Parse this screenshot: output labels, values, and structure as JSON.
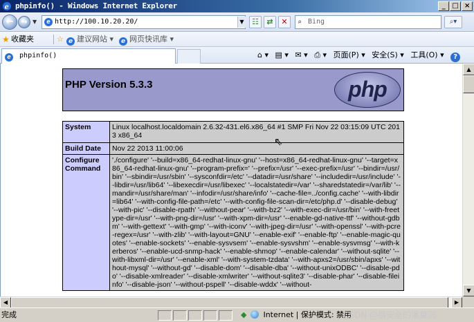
{
  "window": {
    "title": "phpinfo() - Windows Internet Explorer",
    "btn_min": "_",
    "btn_max": "□",
    "btn_close": "×"
  },
  "address": {
    "url": "http://100.10.20.20/",
    "search_placeholder": "Bing"
  },
  "favorites": {
    "label": "收藏夹",
    "items": [
      "建议网站 ▾",
      "网页快讯库 ▾"
    ]
  },
  "tab": {
    "title": "phpinfo()"
  },
  "commandbar": {
    "home": "⌂ ▾",
    "feeds": "▤ ▾",
    "mail": "✉ ▾",
    "print": "⎙ ▾",
    "page": "页面(P) ▾",
    "safety": "安全(S) ▾",
    "tools": "工具(O) ▾",
    "help": "?"
  },
  "php": {
    "version_title": "PHP Version 5.3.3",
    "logo_text": "php",
    "rows": [
      {
        "label": "System",
        "value": "Linux localhost.localdomain 2.6.32-431.el6.x86_64 #1 SMP Fri Nov 22 03:15:09 UTC 2013 x86_64"
      },
      {
        "label": "Build Date",
        "value": "Nov 22 2013 11:00:06"
      },
      {
        "label": "Configure Command",
        "value": "'./configure' '--build=x86_64-redhat-linux-gnu' '--host=x86_64-redhat-linux-gnu' '--target=x86_64-redhat-linux-gnu' '--program-prefix=' '--prefix=/usr' '--exec-prefix=/usr' '--bindir=/usr/bin' '--sbindir=/usr/sbin' '--sysconfdir=/etc' '--datadir=/usr/share' '--includedir=/usr/include' '--libdir=/usr/lib64' '--libexecdir=/usr/libexec' '--localstatedir=/var' '--sharedstatedir=/var/lib' '--mandir=/usr/share/man' '--infodir=/usr/share/info' '--cache-file=../config.cache' '--with-libdir=lib64' '--with-config-file-path=/etc' '--with-config-file-scan-dir=/etc/php.d' '--disable-debug' '--with-pic' '--disable-rpath' '--without-pear' '--with-bz2' '--with-exec-dir=/usr/bin' '--with-freetype-dir=/usr' '--with-png-dir=/usr' '--with-xpm-dir=/usr' '--enable-gd-native-ttf' '--without-gdbm' '--with-gettext' '--with-gmp' '--with-iconv' '--with-jpeg-dir=/usr' '--with-openssl' '--with-pcre-regex=/usr' '--with-zlib' '--with-layout=GNU' '--enable-exif' '--enable-ftp' '--enable-magic-quotes' '--enable-sockets' '--enable-sysvsem' '--enable-sysvshm' '--enable-sysvmsg' '--with-kerberos' '--enable-ucd-snmp-hack' '--enable-shmop' '--enable-calendar' '--without-sqlite' '--with-libxml-dir=/usr' '--enable-xml' '--with-system-tzdata' '--with-apxs2=/usr/sbin/apxs' '--without-mysql' '--without-gd' '--disable-dom' '--disable-dba' '--without-unixODBC' '--disable-pdo' '--disable-xmlreader' '--disable-xmlwriter' '--without-sqlite3' '--disable-phar' '--disable-fileinfo' '--disable-json' '--without-pspell' '--disable-wddx' '--without-"
      }
    ]
  },
  "status": {
    "text": "完成",
    "zone": "Internet | 保护模式: 禁用",
    "watermark": "CSDN @搞安全的潘莫沉"
  },
  "colors": {
    "php_header": "#9999cc",
    "label_cell": "#ccccff",
    "value_cell": "#cccccc"
  }
}
